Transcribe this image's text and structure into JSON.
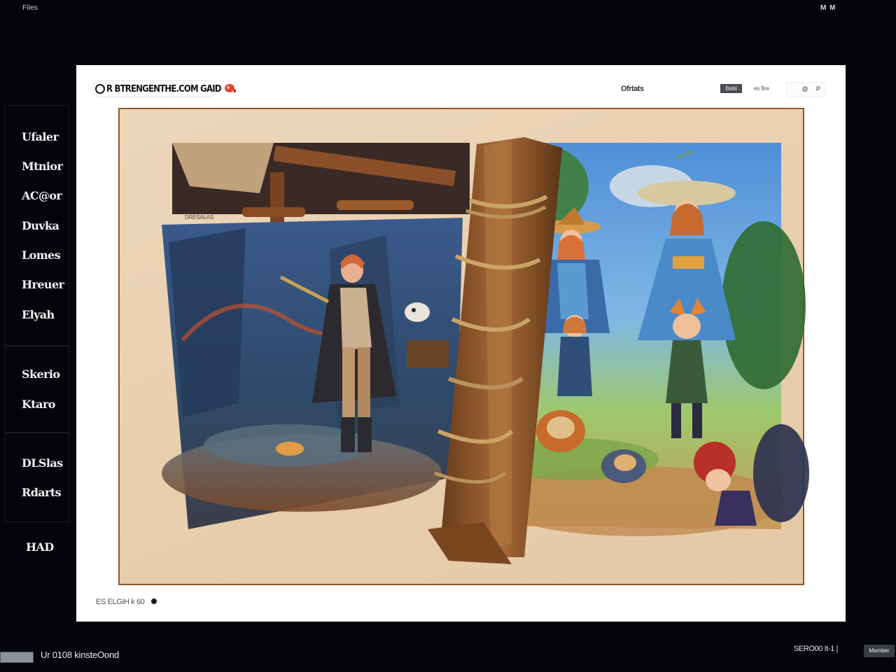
{
  "topbar": {
    "left_label": "Files",
    "right_label": "M M"
  },
  "sidebar": {
    "items": [
      {
        "label": "Ufaler"
      },
      {
        "label": "Mtnior"
      },
      {
        "label": "AC@or"
      },
      {
        "label": "Duvka"
      },
      {
        "label": "Lomes"
      },
      {
        "label": "Hreuer"
      },
      {
        "label": "Elyah"
      }
    ],
    "secondary": [
      {
        "label": "Skerio"
      },
      {
        "label": "Ktaro"
      }
    ],
    "tertiary": [
      {
        "label": "DLSlas"
      },
      {
        "label": "Rdarts"
      }
    ],
    "footer_label": "HAD"
  },
  "card": {
    "brand_text": "R BTRENGENTHE.COM GAID",
    "status_text": "Ofrtats",
    "chip_dark": "Batki",
    "chip_light": "es Bre",
    "controls": [
      "@",
      "P"
    ],
    "art_caption": "DRESALAS",
    "footer_text": "ES ELGIH k 60"
  },
  "statusbar": {
    "progress": 1.0,
    "text": "Ur 0108 kinsteOond",
    "right_text": "SERO00 It-1  |",
    "right_chip": "Mamber"
  },
  "colors": {
    "background": "#04050a",
    "card": "#ffffff",
    "parchment": "#e8cfae",
    "frame_border": "#8a5a2e",
    "brand_badge": "#e2462f"
  },
  "icons": {
    "logo": "ring-logo-icon",
    "badge": "red-blob-badge-icon"
  }
}
